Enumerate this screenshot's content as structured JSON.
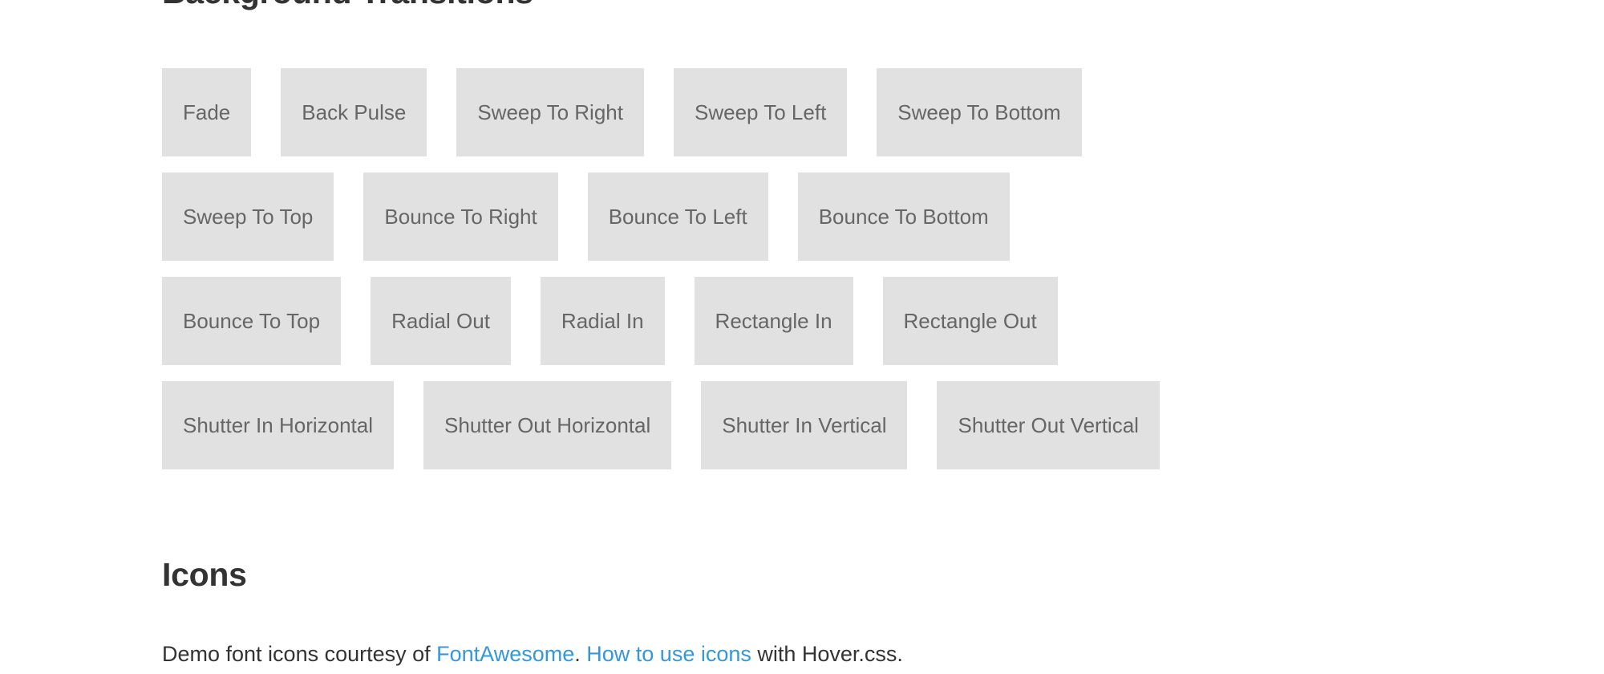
{
  "page": {
    "background_color": "#ffffff",
    "text_color": "#333333",
    "link_color": "#3498db",
    "button_bg_color": "#e1e1e1",
    "button_text_color": "#666666"
  },
  "background_transitions": {
    "heading": "Background Transitions",
    "rows": [
      [
        "Fade",
        "Back Pulse",
        "Sweep To Right",
        "Sweep To Left",
        "Sweep To Bottom"
      ],
      [
        "Sweep To Top",
        "Bounce To Right",
        "Bounce To Left",
        "Bounce To Bottom"
      ],
      [
        "Bounce To Top",
        "Radial Out",
        "Radial In",
        "Rectangle In",
        "Rectangle Out"
      ],
      [
        "Shutter In Horizontal",
        "Shutter Out Horizontal",
        "Shutter In Vertical",
        "Shutter Out Vertical"
      ]
    ]
  },
  "icons": {
    "heading": "Icons",
    "description": {
      "text_before": "Demo font icons courtesy of ",
      "link_1": "FontAwesome",
      "text_middle": ". ",
      "link_2": "How to use icons",
      "text_after": " with Hover.css."
    }
  }
}
